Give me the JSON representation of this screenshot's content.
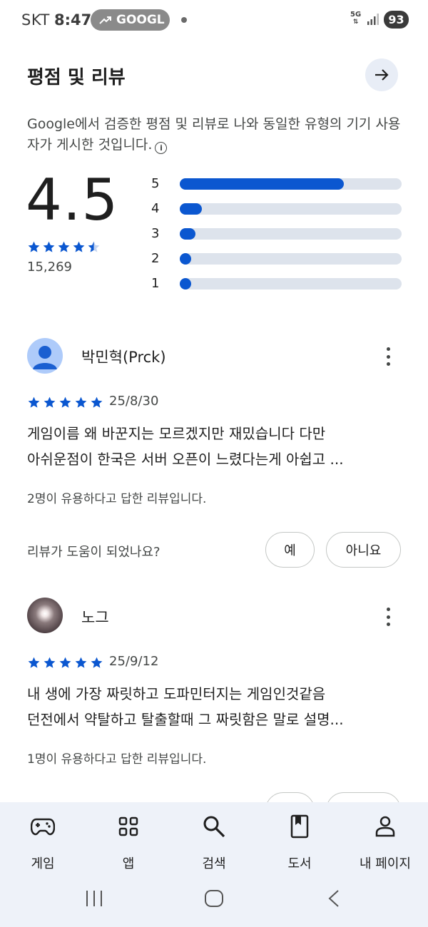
{
  "status_bar": {
    "carrier": "SKT",
    "time": "8:47",
    "ticker": "GOOGL",
    "network": "5G",
    "battery": "93"
  },
  "header": {
    "title": "평점 및 리뷰",
    "arrow_icon": "arrow-right-icon"
  },
  "description": "Google에서 검증한 평점 및 리뷰로 나와 동일한 유형의 기기 사용자가 게시한 것입니다.",
  "rating": {
    "score": "4.5",
    "stars": 4.5,
    "count": "15,269",
    "bars": [
      {
        "label": "5",
        "fraction": 0.74
      },
      {
        "label": "4",
        "fraction": 0.1
      },
      {
        "label": "3",
        "fraction": 0.07
      },
      {
        "label": "2",
        "fraction": 0.05
      },
      {
        "label": "1",
        "fraction": 0.05
      }
    ]
  },
  "reviews": [
    {
      "name": "박민혁(Prck)",
      "stars": 5,
      "date": "25/8/30",
      "text_line1": "게임이름 왜 바꾼지는 모르겠지만 재밌습니다 다만",
      "text_line2": "아쉬운점이 한국은 서버 오픈이 느렸다는게 아쉽고 ...",
      "helpful": "2명이 유용하다고 답한 리뷰입니다.",
      "question": "리뷰가 도움이 되었나요?",
      "yes": "예",
      "no": "아니요"
    },
    {
      "name": "노그",
      "stars": 5,
      "date": "25/9/12",
      "text_line1": "내 생에 가장 짜릿하고 도파민터지는 게임인것같음",
      "text_line2": "던전에서 약탈하고 탈출할때 그 짜릿함은 말로 설명...",
      "helpful": "1명이 유용하다고 답한 리뷰입니다."
    }
  ],
  "bottom_nav": [
    {
      "label": "게임",
      "icon": "gamepad-icon"
    },
    {
      "label": "앱",
      "icon": "apps-grid-icon"
    },
    {
      "label": "검색",
      "icon": "search-icon"
    },
    {
      "label": "도서",
      "icon": "book-icon"
    },
    {
      "label": "내 페이지",
      "icon": "person-icon"
    }
  ],
  "colors": {
    "accent": "#0b57d0",
    "track": "#dde3ec",
    "nav_bg": "#eef2f9"
  }
}
